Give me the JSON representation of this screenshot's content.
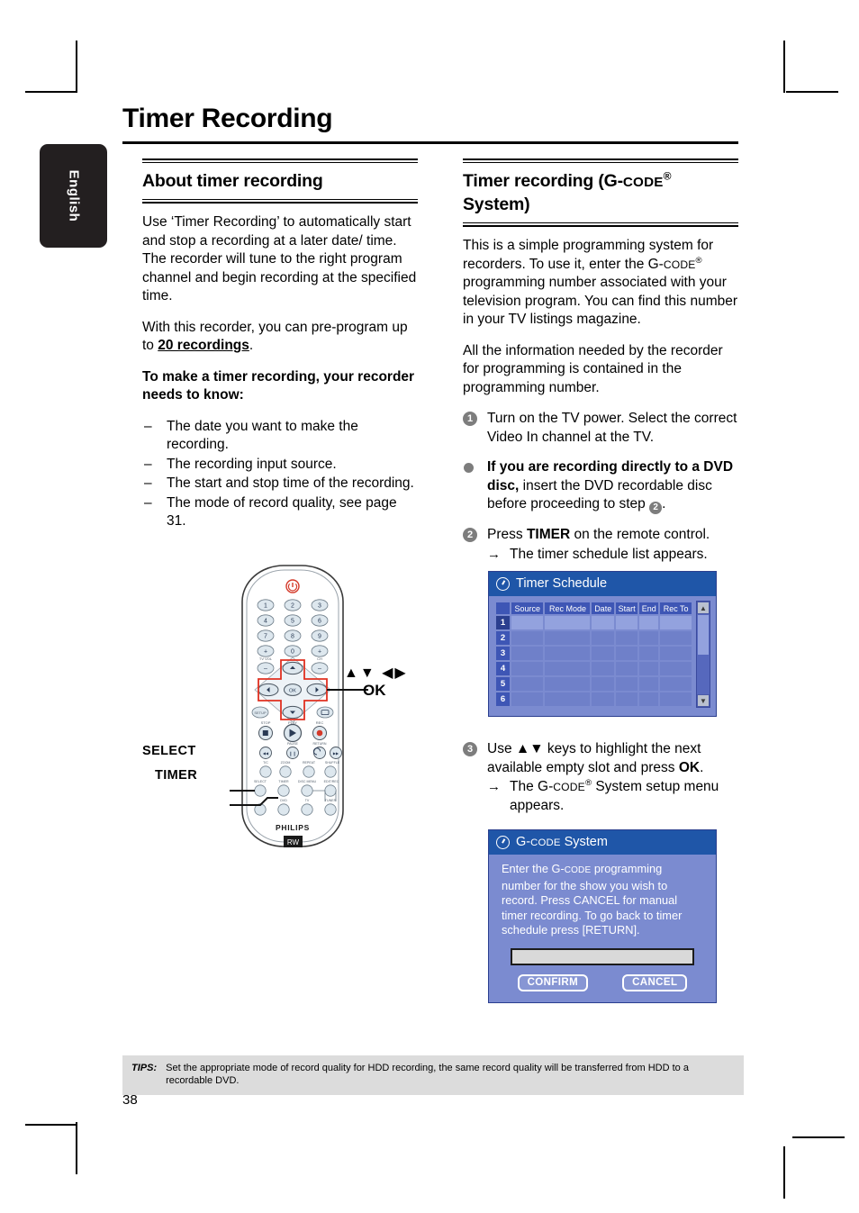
{
  "language_tab": "English",
  "page_title": "Timer Recording",
  "page_number": "38",
  "left_column": {
    "heading": "About timer recording",
    "para1": "Use ‘Timer Recording’ to automatically start and stop a recording at a later date/ time. The recorder will tune to the right program channel and begin recording at the specified time.",
    "para2_pre": "With this recorder, you can pre-program up to ",
    "para2_underline": "20 recordings",
    "para2_post": ".",
    "subheading": "To make a timer recording, your recorder needs to know:",
    "bullets": [
      "The date you want to make the recording.",
      "The recording input source.",
      "The start and stop time of the recording.",
      "The mode of record quality, see page 31."
    ],
    "remote_labels": {
      "select": "SELECT",
      "timer": "TIMER",
      "arrows": "▲▼ ◀▶",
      "ok": "OK",
      "brand": "PHILIPS"
    }
  },
  "right_column": {
    "heading_part1": "Timer recording (G-",
    "heading_smallcaps": "CODE",
    "heading_sup": "®",
    "heading_part2": "System)",
    "para1_a": "This is a simple programming system for recorders. To use it, enter the G-",
    "para1_sc": "CODE",
    "para1_sup": "®",
    "para1_b": " programming number associated with your television program. You can find this number in your TV listings magazine.",
    "para2": "All the information needed by the recorder for programming is contained in the programming number.",
    "steps": [
      {
        "num": "1",
        "text": "Turn on the TV power. Select the correct Video In channel at the TV."
      },
      {
        "num": "•",
        "bold": "If you are recording directly to a DVD disc,",
        "text": " insert the DVD recordable disc before proceeding to step ",
        "inline_num": "2",
        "text_after": "."
      },
      {
        "num": "2",
        "pre": "Press ",
        "bold": "TIMER",
        "post": " on the remote control.",
        "sub": "The timer schedule list appears."
      },
      {
        "num": "3",
        "pre": "Use ▲▼ keys to highlight the next available empty slot and press ",
        "bold": "OK",
        "post": ".",
        "sub_pre": "The G-",
        "sub_sc": "CODE",
        "sub_sup": "®",
        "sub_post": " System setup menu appears."
      }
    ]
  },
  "timer_schedule": {
    "title": "Timer Schedule",
    "columns": [
      "Source",
      "Rec Mode",
      "Date",
      "Start",
      "End",
      "Rec To"
    ],
    "rows": [
      {
        "index": "1",
        "selected": true,
        "cells": [
          "",
          "",
          "",
          "",
          "",
          ""
        ]
      },
      {
        "index": "2",
        "selected": false,
        "cells": [
          "",
          "",
          "",
          "",
          "",
          ""
        ]
      },
      {
        "index": "3",
        "selected": false,
        "cells": [
          "",
          "",
          "",
          "",
          "",
          ""
        ]
      },
      {
        "index": "4",
        "selected": false,
        "cells": [
          "",
          "",
          "",
          "",
          "",
          ""
        ]
      },
      {
        "index": "5",
        "selected": false,
        "cells": [
          "",
          "",
          "",
          "",
          "",
          ""
        ]
      },
      {
        "index": "6",
        "selected": false,
        "cells": [
          "",
          "",
          "",
          "",
          "",
          ""
        ]
      }
    ],
    "scroll_up": "▲",
    "scroll_down": "▼"
  },
  "gcode_dialog": {
    "title_pre": "G-",
    "title_sc": "CODE",
    "title_post": " System",
    "body_a": "Enter the G-",
    "body_sc": "CODE",
    "body_b": " programming number for the show you wish to record. Press CANCEL for manual timer recording. To go back to timer schedule press [RETURN].",
    "input_value": "",
    "confirm": "CONFIRM",
    "cancel": "CANCEL"
  },
  "tips": {
    "label": "TIPS:",
    "text": "Set the appropriate mode of record quality for HDD recording, the same record quality will be transferred from HDD to a recordable DVD."
  },
  "colors": {
    "osd_header": "#1f56a8",
    "osd_body": "#7b8bd0",
    "tab_black": "#231f20",
    "tips_bg": "#dcdcdc",
    "step_gray": "#7d7d7d",
    "highlight_red": "#e03020"
  }
}
